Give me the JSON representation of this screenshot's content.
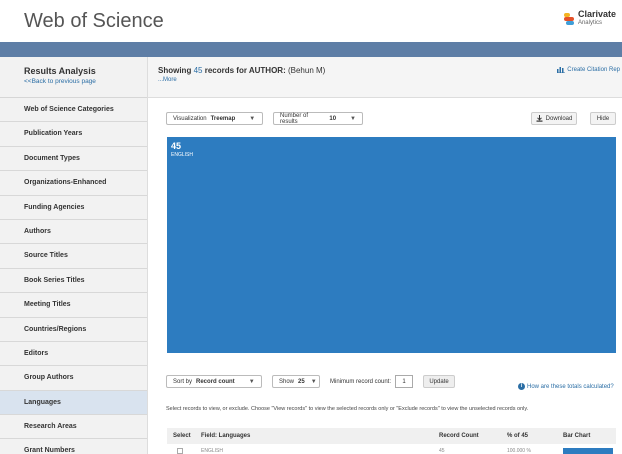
{
  "header": {
    "brand": "Web of Science",
    "vendor_line1": "Clarivate",
    "vendor_line2": "Analytics"
  },
  "sidebar": {
    "title": "Results Analysis",
    "back_link": "<<Back to previous page",
    "items": [
      {
        "label": "Web of Science Categories"
      },
      {
        "label": "Publication Years"
      },
      {
        "label": "Document Types"
      },
      {
        "label": "Organizations-Enhanced"
      },
      {
        "label": "Funding Agencies"
      },
      {
        "label": "Authors"
      },
      {
        "label": "Source Titles"
      },
      {
        "label": "Book Series Titles"
      },
      {
        "label": "Meeting Titles"
      },
      {
        "label": "Countries/Regions"
      },
      {
        "label": "Editors"
      },
      {
        "label": "Group Authors"
      },
      {
        "label": "Languages"
      },
      {
        "label": "Research Areas"
      },
      {
        "label": "Grant Numbers"
      }
    ],
    "active_item": "Languages"
  },
  "main": {
    "showing_prefix": "Showing",
    "count": "45",
    "showing_mid": "records for AUTHOR:",
    "author": "(Behun M)",
    "more": "...More",
    "citation_link": "Create Citation Rep",
    "viz_label": "Visualization",
    "viz_value": "Treemap",
    "results_label": "Number of results",
    "results_value": "10",
    "download": "Download",
    "hide": "Hide",
    "sort_label": "Sort by",
    "sort_value": "Record count",
    "show_label": "Show",
    "show_value": "25",
    "min_label": "Minimum record count:",
    "min_value": "1",
    "update": "Update",
    "how_link": "How are these totals calculated?",
    "instructions": "Select records to view, or exclude. Choose \"View records\" to view the selected records only or \"Exclude records\" to view the unselected records only.",
    "table_headers": {
      "select": "Select",
      "field": "Field: Languages",
      "record_count": "Record Count",
      "percent": "% of 45",
      "bar_chart": "Bar Chart"
    },
    "row": {
      "field": "ENGLISH",
      "record_count": "45",
      "percent": "100.000 %",
      "bar_fraction": 1.0
    }
  },
  "chart_data": {
    "type": "treemap",
    "nodes": [
      {
        "label": "ENGLISH",
        "value": 45
      }
    ]
  },
  "colors": {
    "accent_bar": "#5e7ea6",
    "treemap": "#2d7cc0",
    "link": "#2b6ea5",
    "active_item_bg": "#d9e3ef"
  }
}
